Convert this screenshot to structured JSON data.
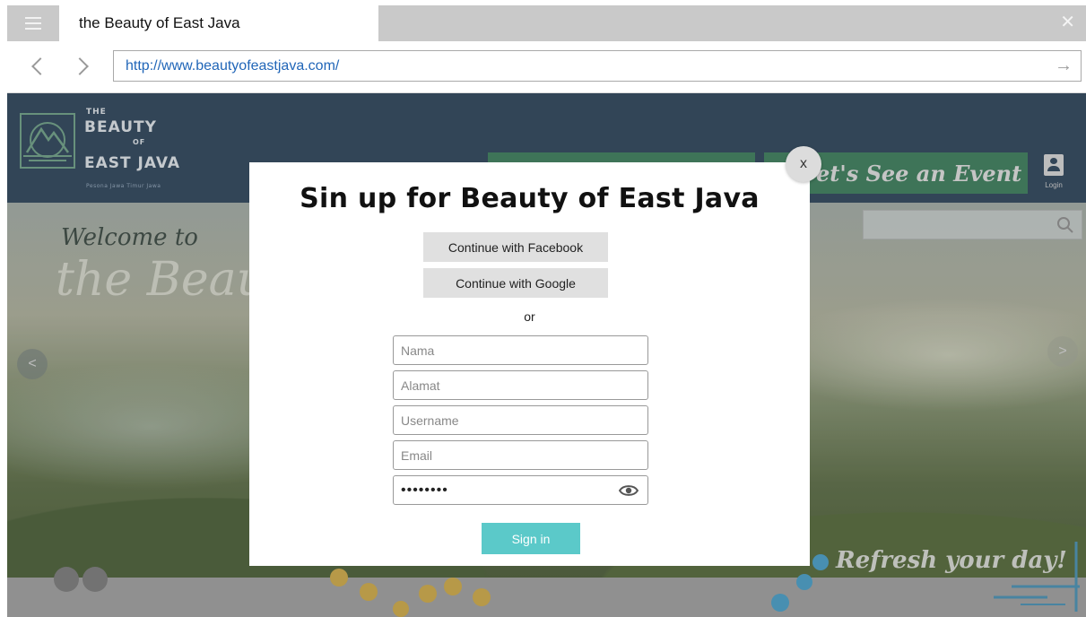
{
  "browser": {
    "tab_title": "the Beauty of East Java",
    "close_glyph": "✕",
    "url": "http://www.beautyofeastjava.com/",
    "go_glyph": "→"
  },
  "site": {
    "logo": {
      "the": "THE",
      "beauty": "BEAUTY",
      "of": "OF",
      "east_java": "EAST JAVA",
      "tagline": "Pesona Jawa Timur Jawa"
    },
    "nav": {
      "event_label": "et's See an Event",
      "login_label": "Login"
    },
    "hero": {
      "welcome": "Welcome to",
      "title": "the Beauty",
      "tagline": "Refresh your day!",
      "prev_glyph": "<",
      "next_glyph": ">"
    },
    "colors": {
      "header_bg": "#32475c",
      "nav_button": "#3f7d5d",
      "signin_button": "#5bc9c9",
      "dot_gold": "#c9a74a",
      "dot_blue": "#4a9bc2"
    }
  },
  "modal": {
    "close_label": "x",
    "title": "Sin up for Beauty of East Java",
    "facebook_label": "Continue with Facebook",
    "google_label": "Continue with Google",
    "or_label": "or",
    "fields": {
      "nama_placeholder": "Nama",
      "alamat_placeholder": "Alamat",
      "username_placeholder": "Username",
      "email_placeholder": "Email",
      "password_value": "••••••••"
    },
    "signin_label": "Sign in"
  }
}
